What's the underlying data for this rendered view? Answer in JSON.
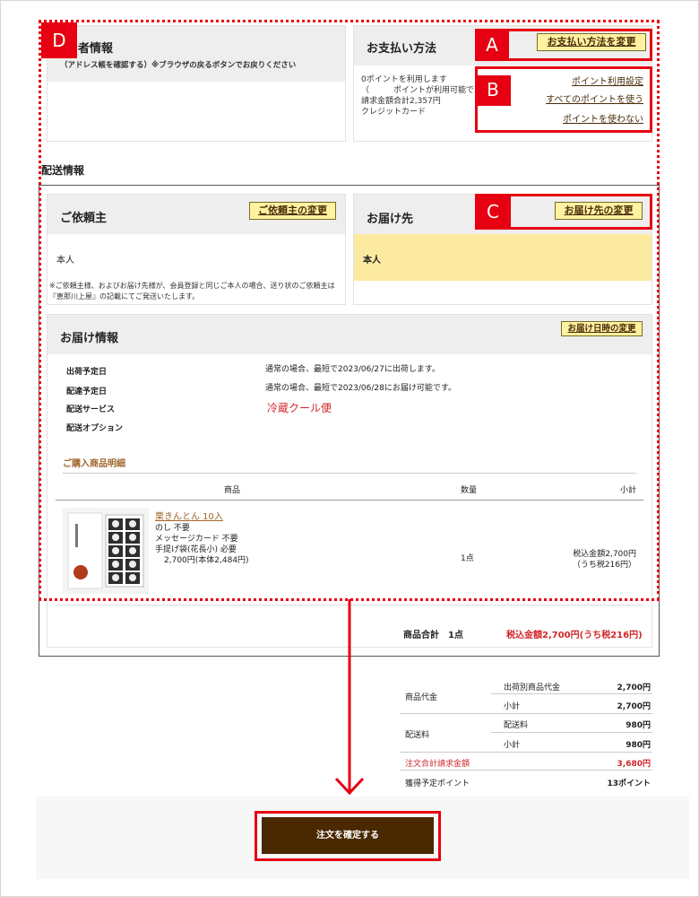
{
  "orderer": {
    "title_partial": "者情報",
    "note": "（アドレス帳を確認する）※ブラウザの戻るボタンでお戻りください"
  },
  "payment": {
    "title": "お支払い方法",
    "change_button": "お支払い方法を変更",
    "lines": [
      "0ポイントを利用します",
      "（　　　ポイントが利用可能です）",
      "請求金額合計2,357円",
      "クレジットカード"
    ],
    "links": [
      "ポイント利用設定",
      "すべてのポイントを使う",
      "ポイントを使わない"
    ]
  },
  "shipping": {
    "section_title": "配送情報",
    "client": {
      "title": "ご依頼主",
      "change_button": "ご依頼主の変更",
      "name": "本人",
      "note": "※ご依頼主様、およびお届け先様が、会員登録と同じご本人の場合、送り状のご依頼主は『恵那川上屋』の記載にてご発送いたします。"
    },
    "recipient": {
      "title": "お届け先",
      "change_button": "お届け先の変更",
      "name": "本人"
    },
    "delivery": {
      "title": "お届け情報",
      "change_button": "お届け日時の変更",
      "rows": [
        {
          "label": "出荷予定日",
          "value": "通常の場合、最短で2023/06/27に出荷します。"
        },
        {
          "label": "配達予定日",
          "value": "通常の場合、最短で2023/06/28にお届け可能です。"
        },
        {
          "label": "配送サービス",
          "value": "冷蔵クール便"
        },
        {
          "label": "配送オプション",
          "value": ""
        }
      ]
    }
  },
  "items": {
    "title": "ご購入商品明細",
    "headers": {
      "product": "商品",
      "qty": "数量",
      "subtotal": "小計"
    },
    "product": {
      "name": "栗きんとん 10入",
      "options": [
        "のし 不要",
        "メッセージカード 不要",
        "手提げ袋(花長小) 必要"
      ],
      "price": "2,700円(本体2,484円)",
      "qty": "1点",
      "subtotal_line1": "税込金額2,700円",
      "subtotal_line2": "（うち税216円）"
    },
    "total_label": "商品合計",
    "total_qty": "1点",
    "total_price": "税込金額2,700円(うち税216円)"
  },
  "summary": {
    "rows": [
      {
        "group": "商品代金",
        "sub": "出荷別商品代金",
        "amount": "2,700円"
      },
      {
        "group": "",
        "sub": "小計",
        "amount": "2,700円"
      },
      {
        "group": "配送料",
        "sub": "配送料",
        "amount": "980円"
      },
      {
        "group": "",
        "sub": "小計",
        "amount": "980円"
      }
    ],
    "grand_label": "注文合計請求金額",
    "grand_amount": "3,680円",
    "points_label": "獲得予定ポイント",
    "points_value": "13ポイント"
  },
  "confirm_button": "注文を確定する",
  "annotations": {
    "a": "A",
    "b": "B",
    "c": "C",
    "d": "D"
  },
  "colors": {
    "accent_red": "#e60012",
    "button_brown": "#4a2800",
    "highlight_yellow": "#fbeaa0",
    "link_brown": "#a0672a"
  }
}
